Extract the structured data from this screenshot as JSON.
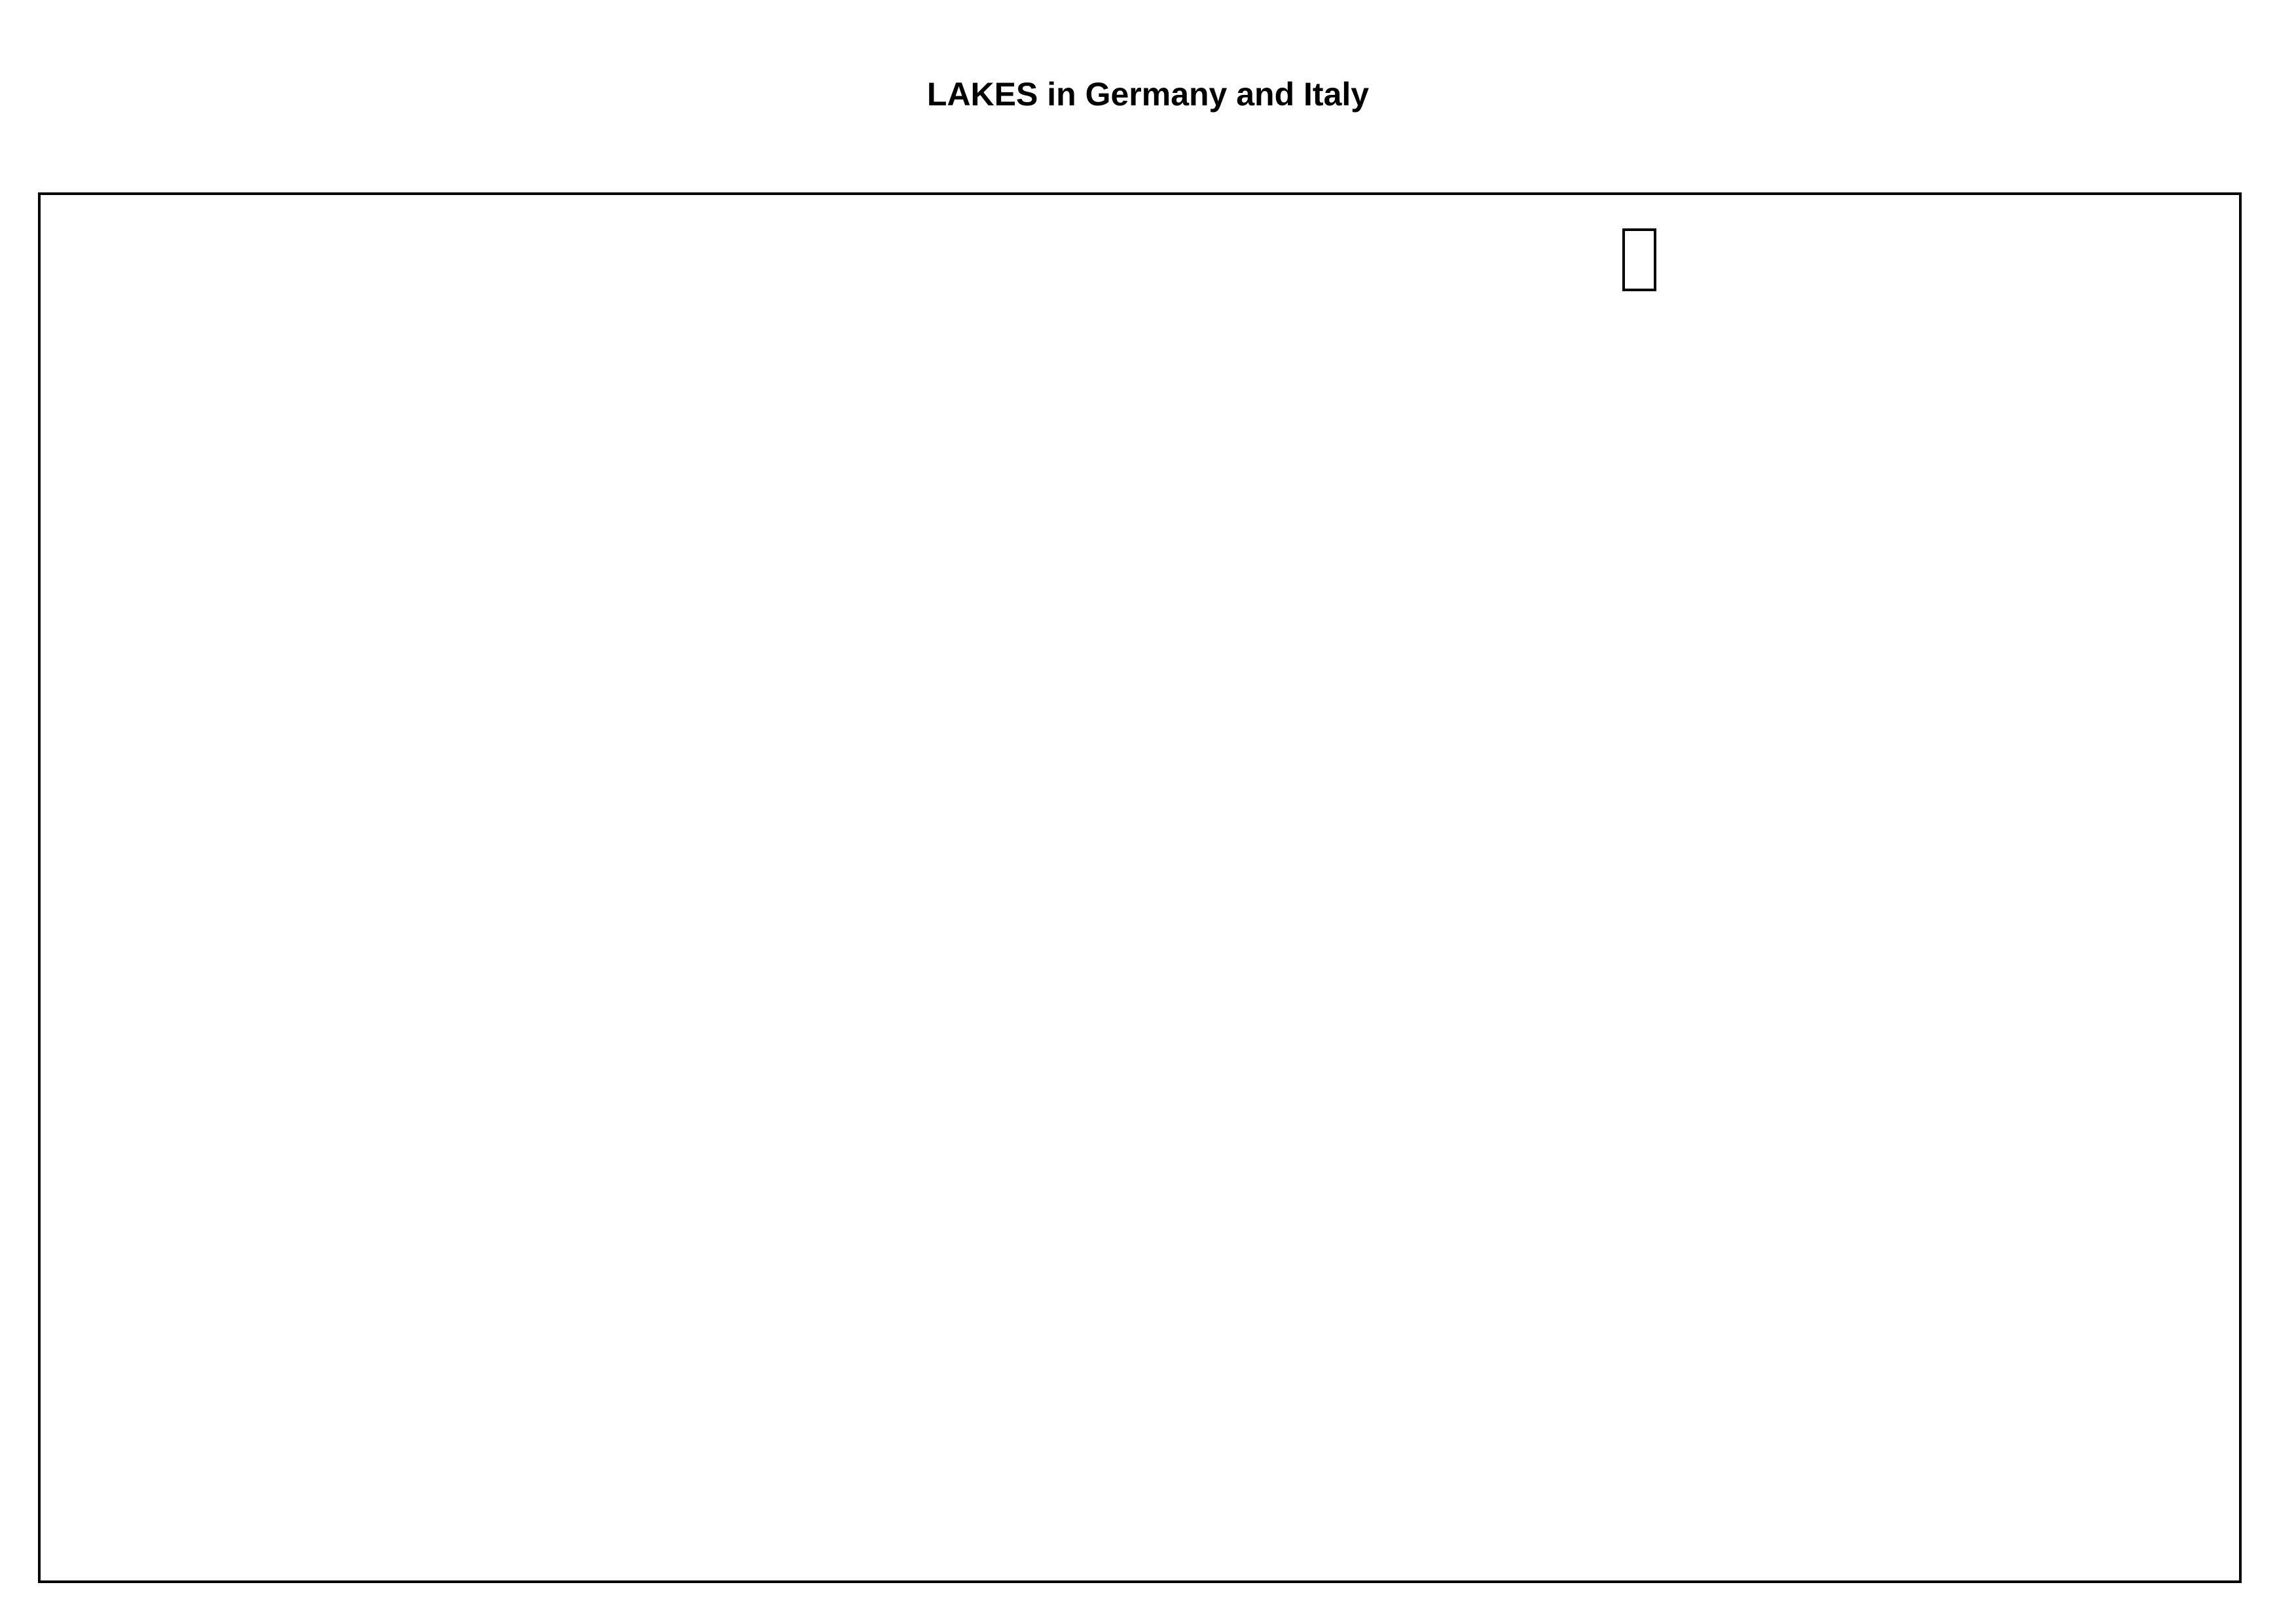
{
  "title": "LAKES in Germany and Italy",
  "map": {
    "frame_color": "#000000",
    "background_color": "#ffffff",
    "marker_icon": "missing-glyph-box"
  }
}
